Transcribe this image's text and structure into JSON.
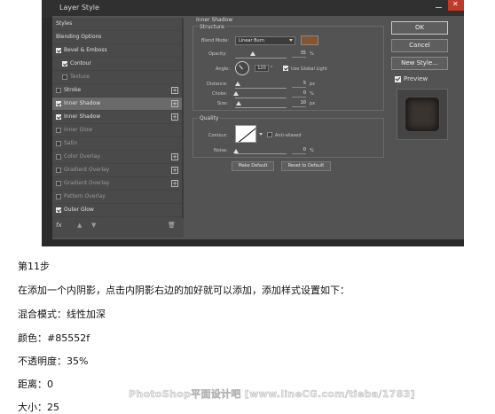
{
  "dialog": {
    "title": "Layer Style",
    "styles_list": [
      {
        "label": "Styles",
        "checkbox": false,
        "checked": false,
        "indent": false,
        "plus": false,
        "dim": false
      },
      {
        "label": "Blending Options",
        "checkbox": false,
        "checked": false,
        "indent": false,
        "plus": false,
        "dim": false
      },
      {
        "label": "Bevel & Emboss",
        "checkbox": true,
        "checked": true,
        "indent": false,
        "plus": false,
        "dim": false
      },
      {
        "label": "Contour",
        "checkbox": true,
        "checked": true,
        "indent": true,
        "plus": false,
        "dim": false
      },
      {
        "label": "Texture",
        "checkbox": true,
        "checked": false,
        "indent": true,
        "plus": false,
        "dim": true
      },
      {
        "label": "Stroke",
        "checkbox": true,
        "checked": false,
        "indent": false,
        "plus": true,
        "dim": false
      },
      {
        "label": "Inner Shadow",
        "checkbox": true,
        "checked": true,
        "indent": false,
        "plus": true,
        "dim": false,
        "selected": true
      },
      {
        "label": "Inner Shadow",
        "checkbox": true,
        "checked": true,
        "indent": false,
        "plus": true,
        "dim": false
      },
      {
        "label": "Inner Glow",
        "checkbox": true,
        "checked": false,
        "indent": false,
        "plus": false,
        "dim": true
      },
      {
        "label": "Satin",
        "checkbox": true,
        "checked": false,
        "indent": false,
        "plus": false,
        "dim": true
      },
      {
        "label": "Color Overlay",
        "checkbox": true,
        "checked": false,
        "indent": false,
        "plus": true,
        "dim": true
      },
      {
        "label": "Gradient Overlay",
        "checkbox": true,
        "checked": false,
        "indent": false,
        "plus": true,
        "dim": true
      },
      {
        "label": "Gradient Overlay",
        "checkbox": true,
        "checked": false,
        "indent": false,
        "plus": true,
        "dim": true
      },
      {
        "label": "Pattern Overlay",
        "checkbox": true,
        "checked": false,
        "indent": false,
        "plus": false,
        "dim": true
      },
      {
        "label": "Outer Glow",
        "checkbox": true,
        "checked": true,
        "indent": false,
        "plus": false,
        "dim": false
      }
    ],
    "bottom_bar": {
      "fx": "fx",
      "up": "▲",
      "down": "▼",
      "trash": "🗑"
    },
    "inner_shadow": {
      "heading": "Inner Shadow",
      "structure_heading": "Structure",
      "blend_mode_label": "Blend Mode:",
      "blend_mode_value": "Linear Burn",
      "swatch_color": "#85552f",
      "opacity_label": "Opacity:",
      "opacity_value": "35",
      "opacity_percent": 35,
      "opacity_unit": "%",
      "angle_label": "Angle:",
      "angle_value": "120",
      "angle_unit": "°",
      "use_global_light_label": "Use Global Light",
      "use_global_light_checked": true,
      "distance_label": "Distance:",
      "distance_value": "5",
      "distance_unit": "px",
      "choke_label": "Choke:",
      "choke_value": "0",
      "choke_unit": "%",
      "size_label": "Size:",
      "size_value": "10",
      "size_unit": "px",
      "quality_heading": "Quality",
      "contour_label": "Contour:",
      "anti_aliased_label": "Anti-aliased",
      "anti_aliased_checked": false,
      "noise_label": "Noise:",
      "noise_value": "0",
      "noise_unit": "%",
      "make_default_label": "Make Default",
      "reset_default_label": "Reset to Default"
    },
    "buttons": {
      "ok": "OK",
      "cancel": "Cancel",
      "new_style": "New Style..."
    },
    "preview_label": "Preview",
    "preview_checked": true
  },
  "article": {
    "step": "第11步",
    "description": "在添加一个内阴影，点击内阴影右边的加好就可以添加，添加样式设置如下：",
    "settings": [
      "混合模式：线性加深",
      "颜色：#85552f",
      "不透明度：35%",
      "距离：0",
      "大小：25"
    ],
    "watermark": "PhotoShop平面设计吧 [www.lineCG.com/tieba/1783]"
  },
  "colors": {
    "dialog_bg": "#535353",
    "panel_bg": "#4a4a4a",
    "selected_row": "#6a6a6a",
    "swatch": "#85552f"
  }
}
